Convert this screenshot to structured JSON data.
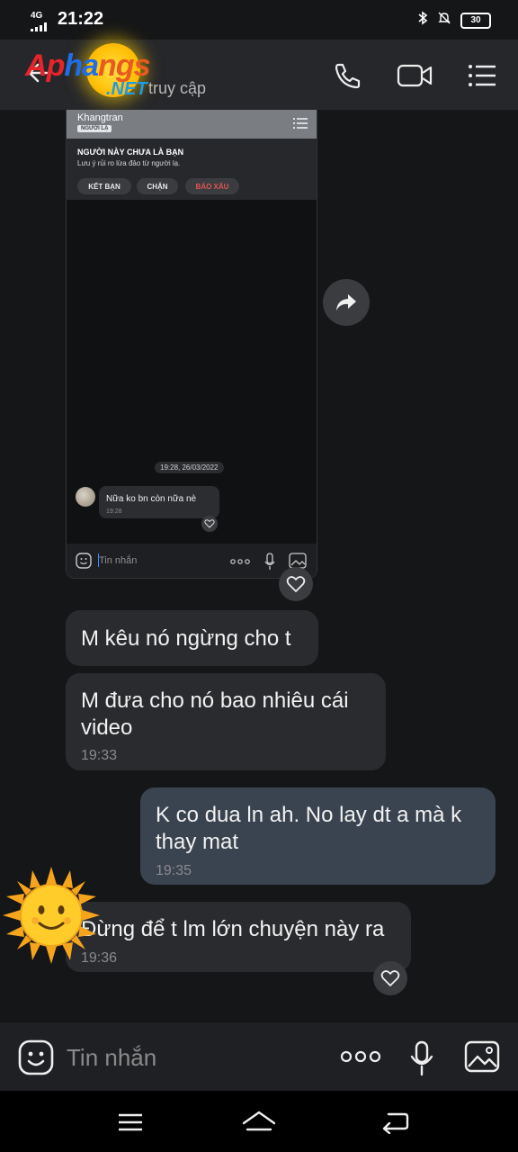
{
  "status_bar": {
    "network": "4G",
    "time": "21:22",
    "battery": "30"
  },
  "header": {
    "watermark_logo": "Aphangs.NET",
    "subtitle": "truy cập",
    "icons": [
      "back-arrow-icon",
      "phone-icon",
      "video-call-icon",
      "menu-icon"
    ]
  },
  "screenshot_card": {
    "contact_name": "Khangtran",
    "stranger_badge": "NGƯỜI LẠ",
    "warning_title": "NGƯỜI NÀY CHƯA LÀ BẠN",
    "warning_text": "Lưu ý rủi ro lừa đảo từ người lạ.",
    "buttons": [
      "KẾT BẠN",
      "CHẶN",
      "BÁO XẤU"
    ],
    "timestamp": "19:28, 26/03/2022",
    "message_text": "Nữa ko bn còn nữa nè",
    "message_time": "19:28",
    "input_placeholder": "Tin nhắn"
  },
  "messages": [
    {
      "direction": "in",
      "text": "M kêu nó ngừng cho t",
      "time": ""
    },
    {
      "direction": "in",
      "text": "M đưa cho nó bao nhiêu cái video",
      "time": "19:33"
    },
    {
      "direction": "out",
      "text": "K co dua ln ah. No lay dt a mà k thay mat",
      "time": "19:35"
    },
    {
      "direction": "in",
      "text": "Đừng để t lm lớn chuyện này ra",
      "time": "19:36"
    }
  ],
  "input_bar": {
    "placeholder": "Tin nhắn",
    "icons": [
      "sticker-icon",
      "more-icon",
      "microphone-icon",
      "image-icon"
    ]
  },
  "nav_bar": {
    "icons": [
      "recent-apps-icon",
      "home-icon",
      "back-icon"
    ]
  }
}
